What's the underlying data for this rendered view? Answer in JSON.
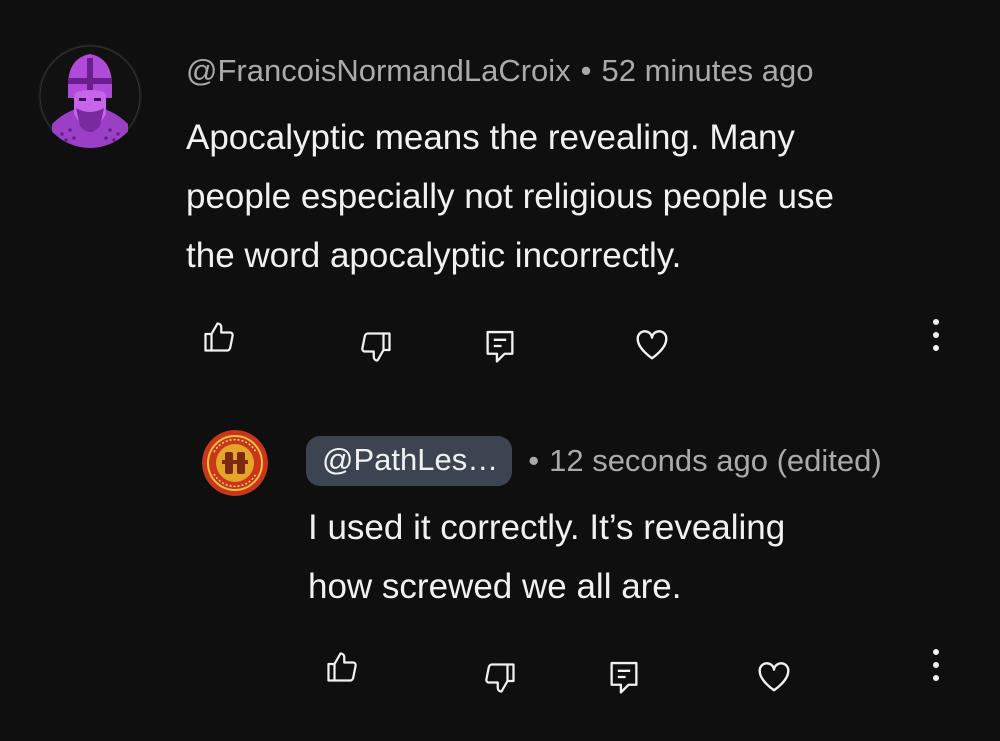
{
  "comments": [
    {
      "author": "@FrancoisNormandLaCroix",
      "separator": "•",
      "time": "52 minutes ago",
      "text": "Apocalyptic means the revealing. Many\npeople especially not religious people use\nthe word apocalyptic incorrectly.",
      "avatar": "knight-helmet-avatar",
      "avatar_color": "#b04ad8",
      "actions": [
        "like-icon",
        "dislike-icon",
        "reply-icon",
        "heart-icon",
        "more-vertical-icon"
      ]
    },
    {
      "author": "@PathLes…",
      "separator": "•",
      "time": "12 seconds ago (edited)",
      "text": "I used it correctly. It’s revealing\nhow screwed we all are.",
      "avatar": "seal-emblem-avatar",
      "avatar_color": "#c04a1c",
      "actions": [
        "like-icon",
        "dislike-icon",
        "reply-icon",
        "heart-icon",
        "more-vertical-icon"
      ]
    }
  ],
  "colors": {
    "background": "#0f0f0f",
    "text_primary": "#f1f1f1",
    "text_secondary": "#aaaaaa",
    "mention_chip": "#3d4451"
  }
}
